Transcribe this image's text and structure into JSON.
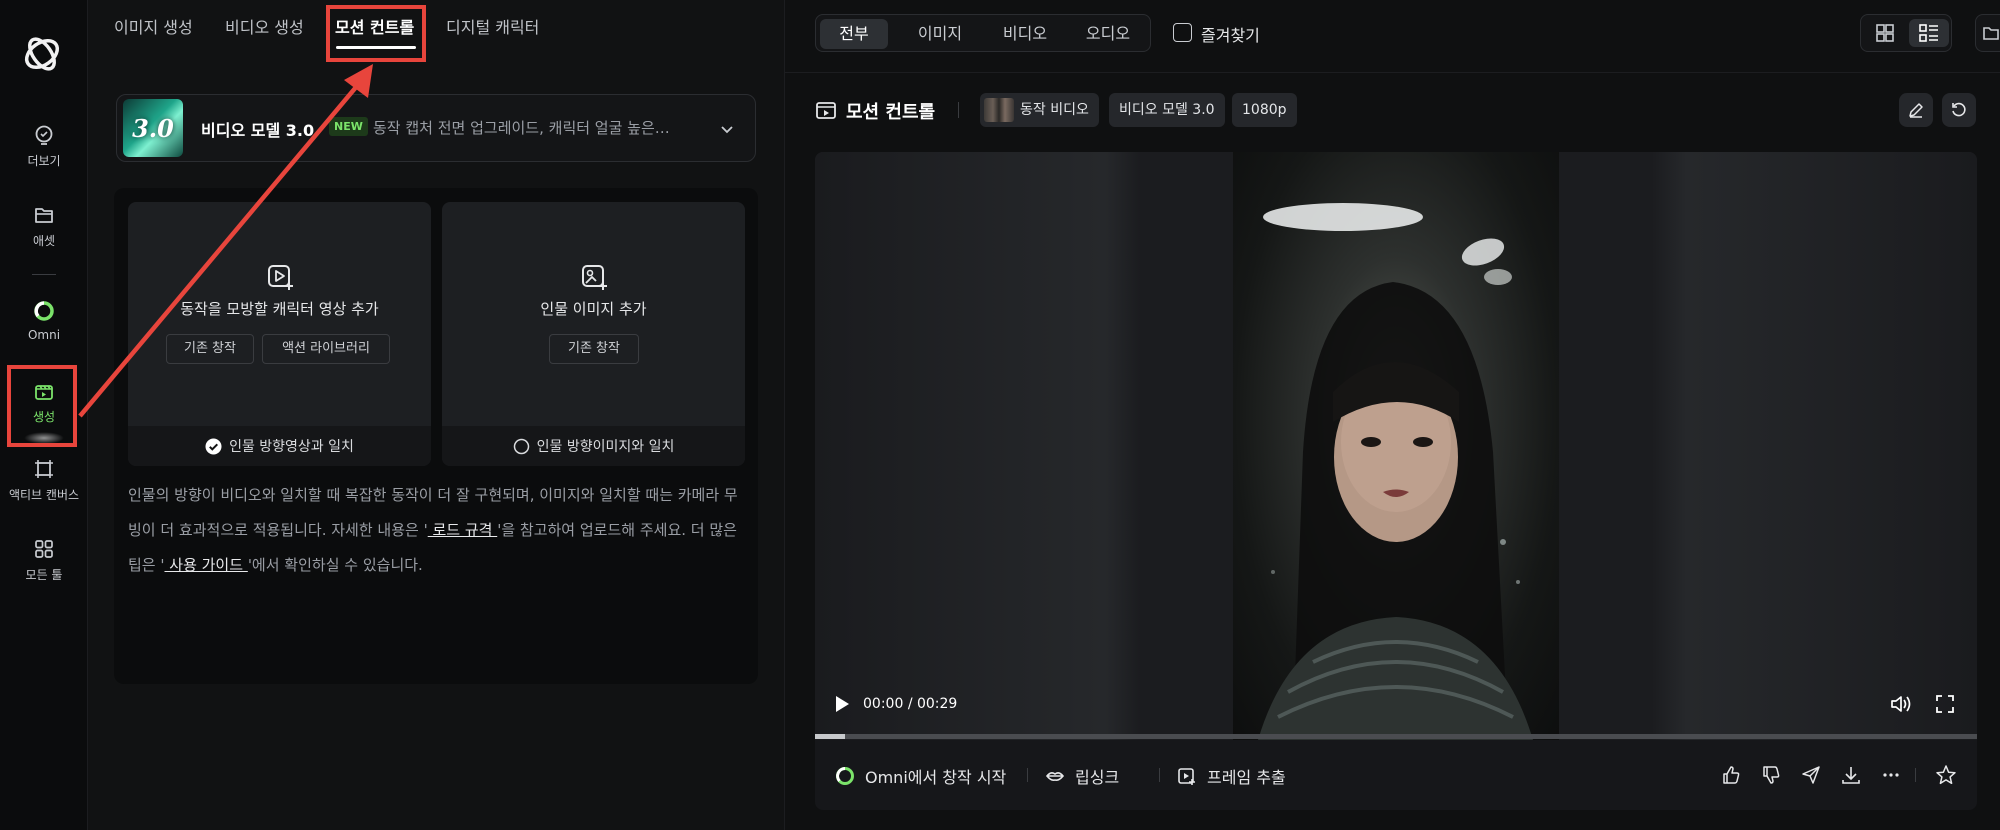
{
  "sidebar": {
    "items": [
      {
        "label": "더보기",
        "icon": "lightbulb-icon"
      },
      {
        "label": "애셋",
        "icon": "folder-icon"
      },
      {
        "label": "Omni",
        "icon": "omni-ring-icon"
      },
      {
        "label": "생성",
        "icon": "create-clapper-icon",
        "active": true
      },
      {
        "label": "액티브 캔버스",
        "icon": "canvas-icon"
      },
      {
        "label": "모든 툴",
        "icon": "grid-icon"
      }
    ]
  },
  "left": {
    "tabs": [
      "이미지 생성",
      "비디오 생성",
      "모션 컨트롤",
      "디지털 캐릭터"
    ],
    "active_tab": 2,
    "model": {
      "badge_text": "3.0",
      "name": "비디오 모델 3.0",
      "new_tag": "NEW",
      "description": "동작 캡처 전면 업그레이드, 캐릭터 얼굴 높은…"
    },
    "upload_video": {
      "title": "동작을 모방할 캐릭터 영상 추가",
      "buttons": [
        "기존 창작",
        "액션 라이브러리"
      ],
      "option": "인물 방향영상과 일치",
      "selected": true
    },
    "upload_image": {
      "title": "인물 이미지 추가",
      "buttons": [
        "기존 창작"
      ],
      "option": "인물 방향이미지와 일치",
      "selected": false
    },
    "description": {
      "part1": "인물의 방향이 비디오와 일치할 때 복잡한 동작이 더 잘 구현되며, 이미지와 일치할 때는 카메라 무빙이 더 효과적으로 적용됩니다. 자세한 내용은 '",
      "link1": " 로드 규격 ",
      "part2": "'을 참고하여 업로드해 주세요. 더 많은 팁은 '",
      "link2": " 사용 가이드 ",
      "part3": "'에서 확인하실 수 있습니다."
    }
  },
  "right": {
    "filters": [
      "전부",
      "이미지",
      "비디오",
      "오디오"
    ],
    "active_filter": 0,
    "favorites_label": "즐겨찾기",
    "title": "모션 컨트롤",
    "chips": [
      "동작 비디오",
      "비디오 모델 3.0",
      "1080p"
    ],
    "player": {
      "current_time": "00:00",
      "separator": "/",
      "duration": "00:29",
      "progress": 0.026
    },
    "actions": {
      "omni": "Omni에서 창작 시작",
      "lipsync": "립싱크",
      "frame": "프레임 추출"
    }
  },
  "colors": {
    "accent_green": "#7be36a",
    "annotation_red": "#e8453c",
    "background": "#111213"
  }
}
